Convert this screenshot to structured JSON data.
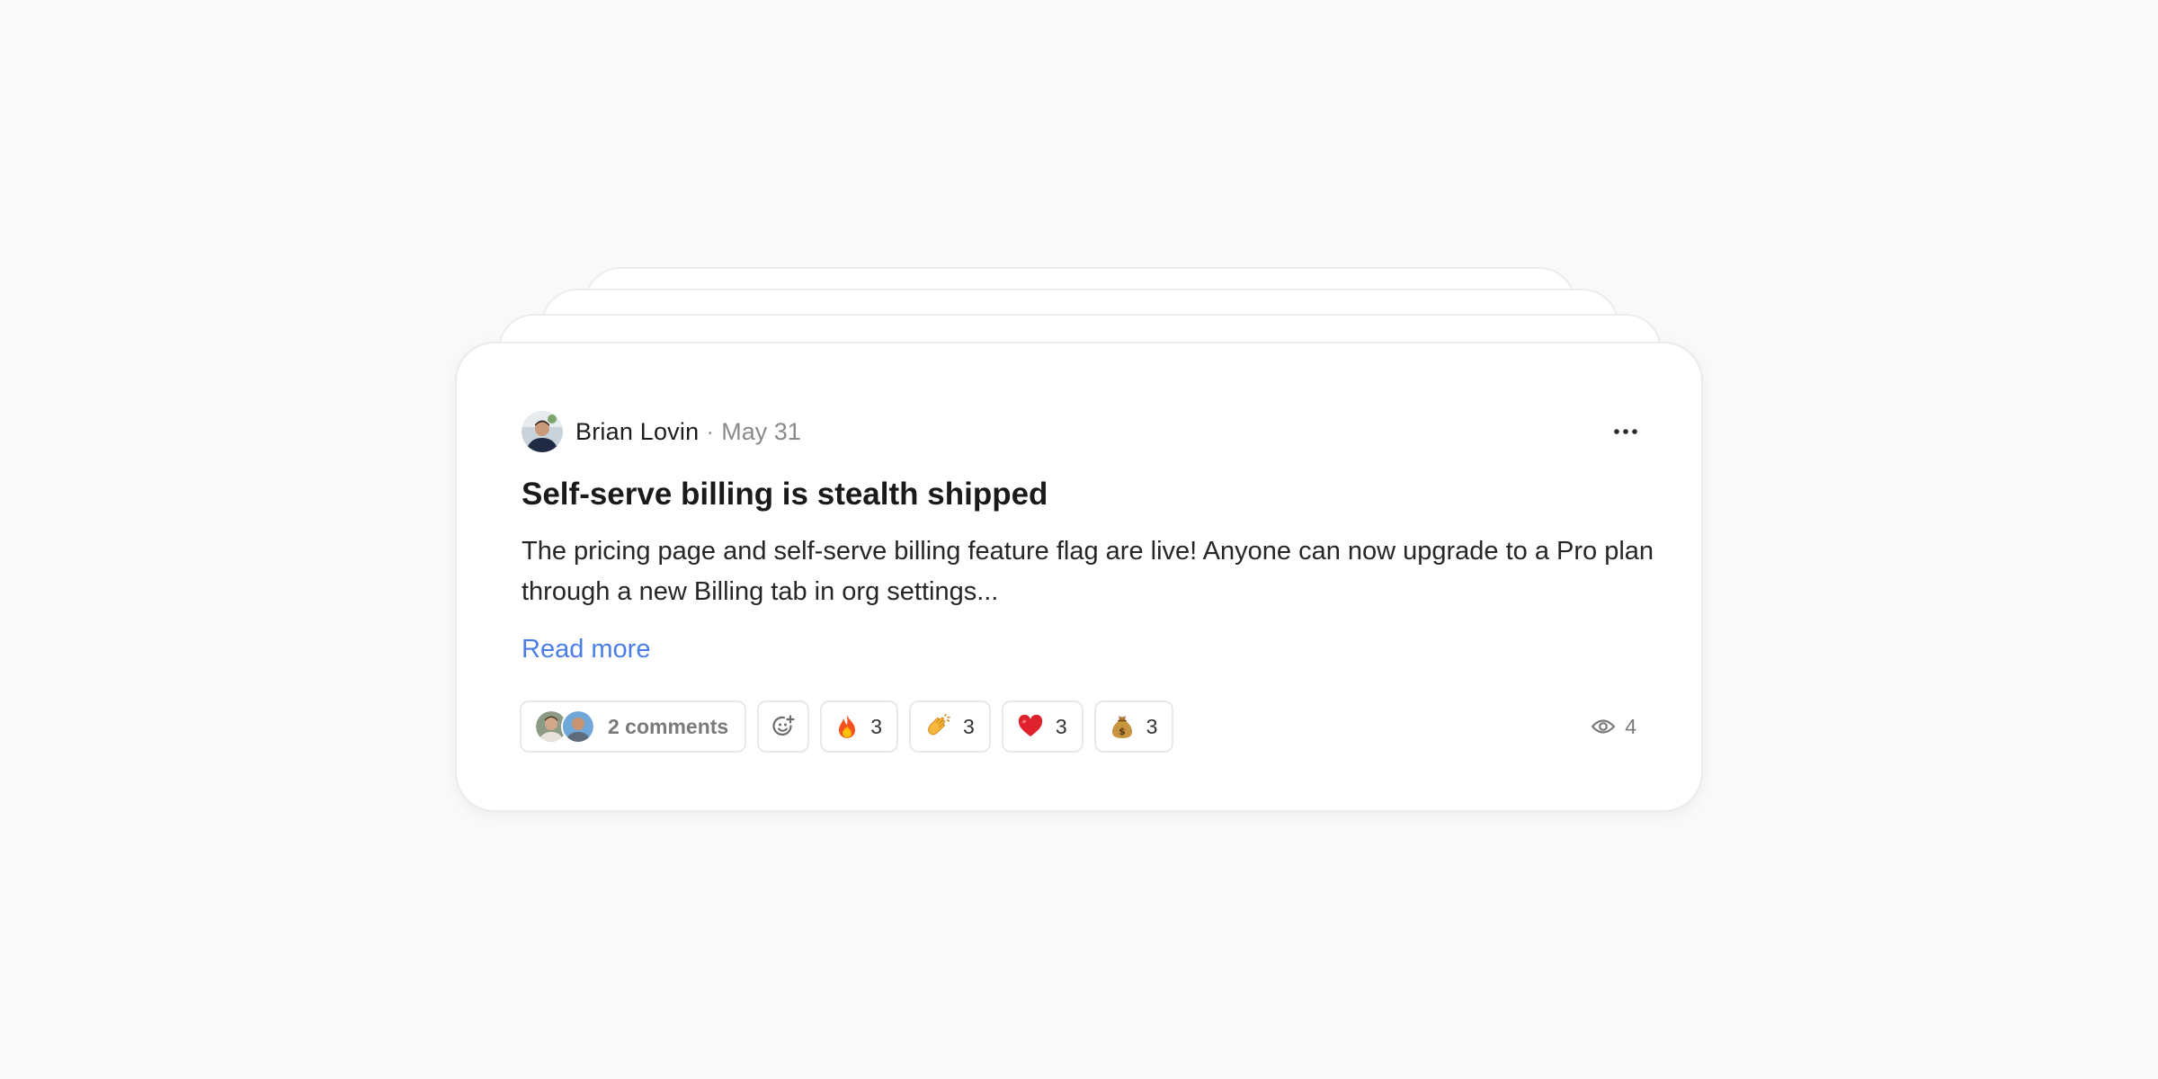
{
  "post": {
    "author": {
      "name": "Brian Lovin",
      "separator": "·",
      "date": "May 31"
    },
    "title": "Self-serve billing is stealth shipped",
    "excerpt": "The pricing page and self-serve billing feature flag are live! Anyone can now upgrade to a Pro plan through a new Billing tab in org settings...",
    "read_more_label": "Read more",
    "comments": {
      "label": "2 comments",
      "commenter_avatars": [
        "commenter-avatar-1",
        "commenter-avatar-2"
      ]
    },
    "add_reaction_icon": "add-emoji-icon",
    "reactions": [
      {
        "emoji": "🔥",
        "icon": "fire-icon",
        "count": "3"
      },
      {
        "emoji": "👏",
        "icon": "clapping-hands-icon",
        "count": "3"
      },
      {
        "emoji": "❤️",
        "icon": "red-heart-icon",
        "count": "3"
      },
      {
        "emoji": "💰",
        "icon": "money-bag-icon",
        "count": "3"
      }
    ],
    "views": {
      "icon": "eye-icon",
      "count": "4"
    },
    "more_icon": "more-horizontal-icon"
  },
  "colors": {
    "background": "#f9f9f9",
    "card": "#ffffff",
    "link": "#4a7ee6",
    "title": "#1a1a1a",
    "muted": "#8a8a8a"
  }
}
